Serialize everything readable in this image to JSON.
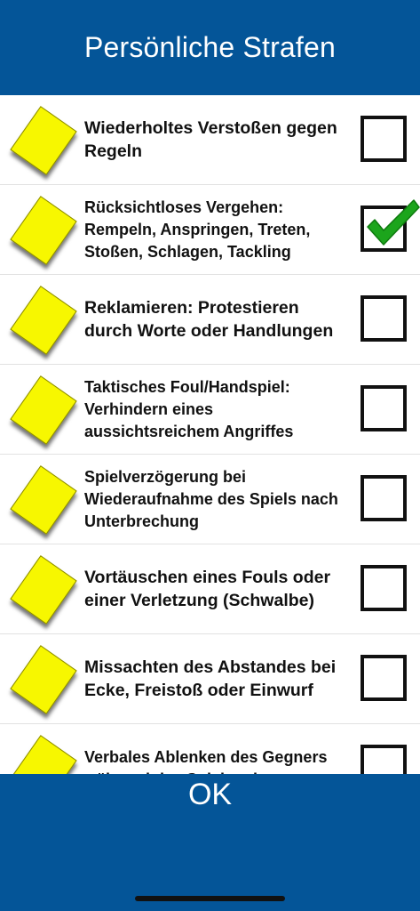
{
  "header": {
    "title": "Persönliche Strafen"
  },
  "colors": {
    "bar": "#045598",
    "card": "#f7f700",
    "check": "#1ca51c"
  },
  "items": [
    {
      "label": "Wiederholtes Verstoßen gegen Regeln",
      "checked": false
    },
    {
      "label": "Rücksichtloses Vergehen: Rempeln, Anspringen, Treten, Stoßen, Schlagen, Tackling",
      "checked": true
    },
    {
      "label": "Reklamieren: Protestieren durch Worte oder Handlungen",
      "checked": false
    },
    {
      "label": "Taktisches Foul/Handspiel: Verhindern eines aussichtsreichem Angriffes",
      "checked": false
    },
    {
      "label": "Spielverzögerung bei Wiederaufnahme des Spiels nach Unterbrechung",
      "checked": false
    },
    {
      "label": "Vortäuschen eines Fouls oder einer Verletzung (Schwalbe)",
      "checked": false
    },
    {
      "label": "Missachten des Abstandes bei Ecke, Freistoß oder Einwurf",
      "checked": false
    },
    {
      "label": "Verbales Ablenken des Gegners während des Spiels oder",
      "checked": false
    }
  ],
  "footer": {
    "ok_label": "OK"
  }
}
